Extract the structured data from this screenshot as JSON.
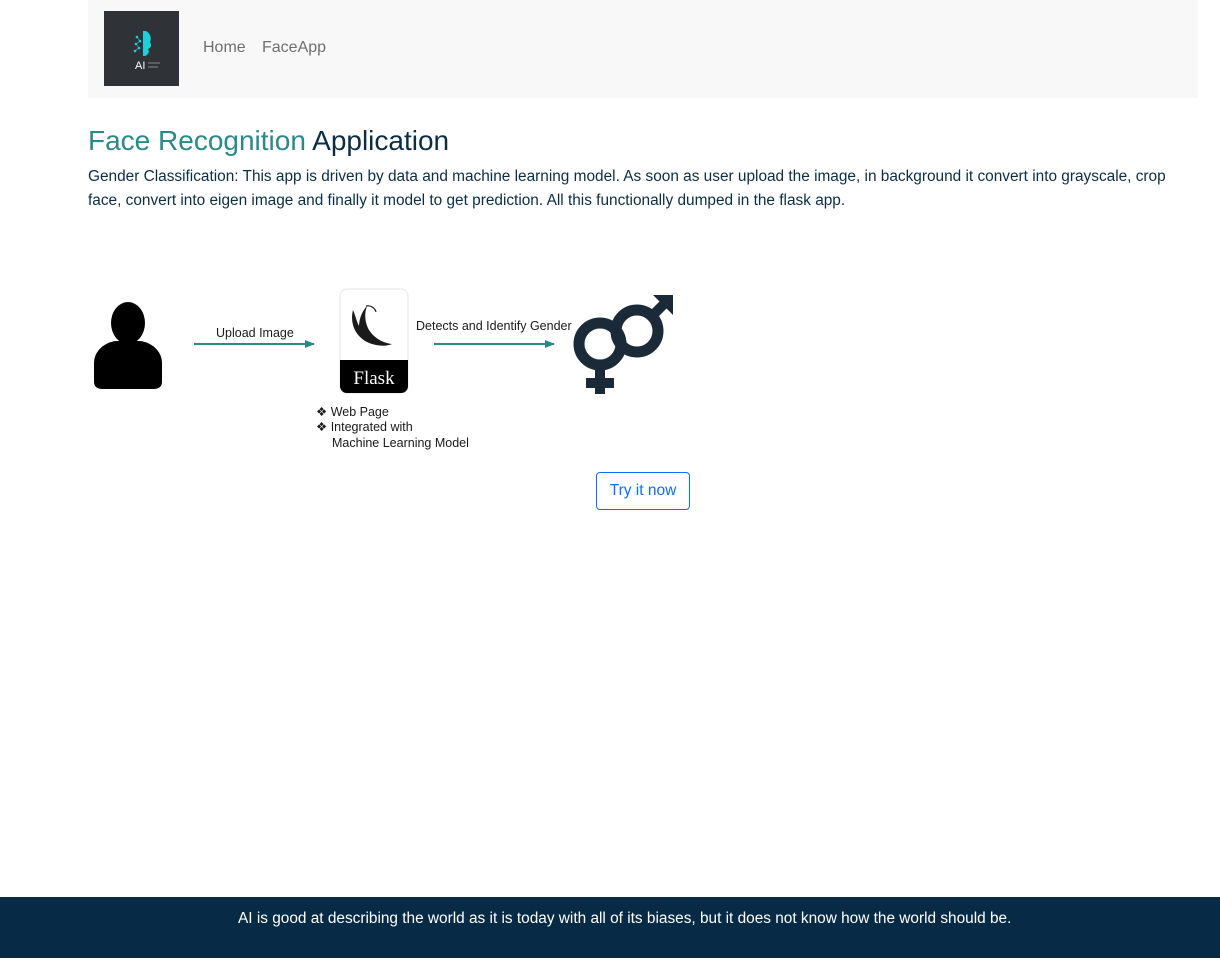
{
  "navbar": {
    "logo_text": "AI",
    "links": [
      {
        "label": "Home"
      },
      {
        "label": "FaceApp"
      }
    ]
  },
  "main": {
    "title_part1": "Face Recognition",
    "title_part2": "Application",
    "description": "Gender Classification: This app is driven by data and machine learning model. As soon as user upload the image, in background it convert into grayscale, crop face, convert into eigen image and finally it model to get prediction. All this functionally dumped in the flask app."
  },
  "diagram": {
    "upload_label": "Upload Image",
    "detect_label": "Detects and Identify Gender",
    "flask_label": "Flask",
    "bullets": [
      "Web Page",
      "Integrated with",
      "Machine Learning Model"
    ],
    "arrow_color": "#2a8a8a"
  },
  "cta": {
    "label": "Try it now"
  },
  "footer": {
    "quote": "AI is good at describing the world as it is today with all of its biases, but it does not know how the world should be."
  }
}
